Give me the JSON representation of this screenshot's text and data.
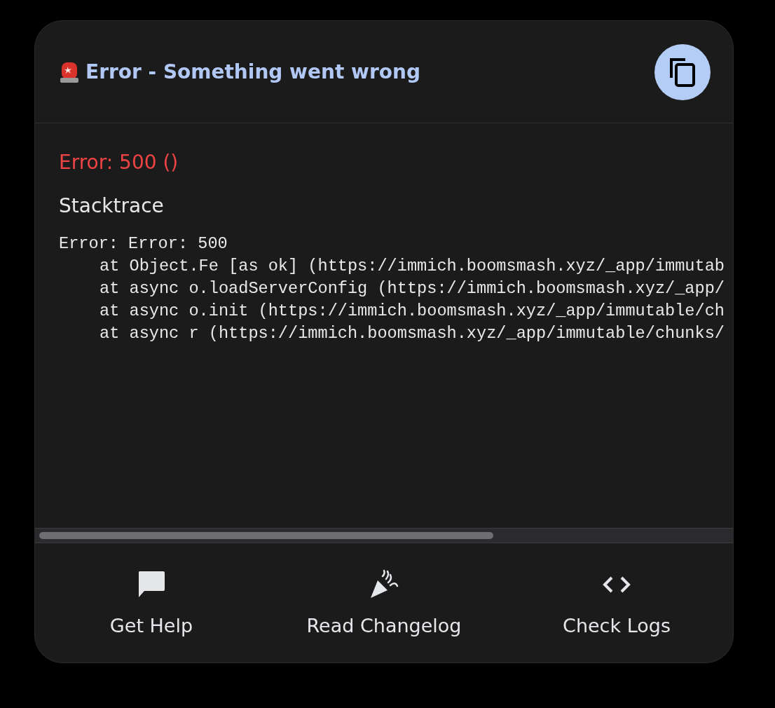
{
  "header": {
    "title": "Error - Something went wrong",
    "copy_button": {
      "kind": "copy"
    }
  },
  "error": {
    "message": "Error: 500 ()",
    "stacktrace_heading": "Stacktrace",
    "stacktrace": {
      "first_line": "Error: Error: 500",
      "frames": [
        "at Object.Fe [as ok] (https://immich.boomsmash.xyz/_app/immutab",
        "at async o.loadServerConfig (https://immich.boomsmash.xyz/_app/",
        "at async o.init (https://immich.boomsmash.xyz/_app/immutable/ch",
        "at async r (https://immich.boomsmash.xyz/_app/immutable/chunks/"
      ]
    }
  },
  "actions": [
    {
      "label": "Get Help",
      "kind": "help"
    },
    {
      "label": "Read Changelog",
      "kind": "changelog"
    },
    {
      "label": "Check Logs",
      "kind": "logs"
    }
  ]
}
